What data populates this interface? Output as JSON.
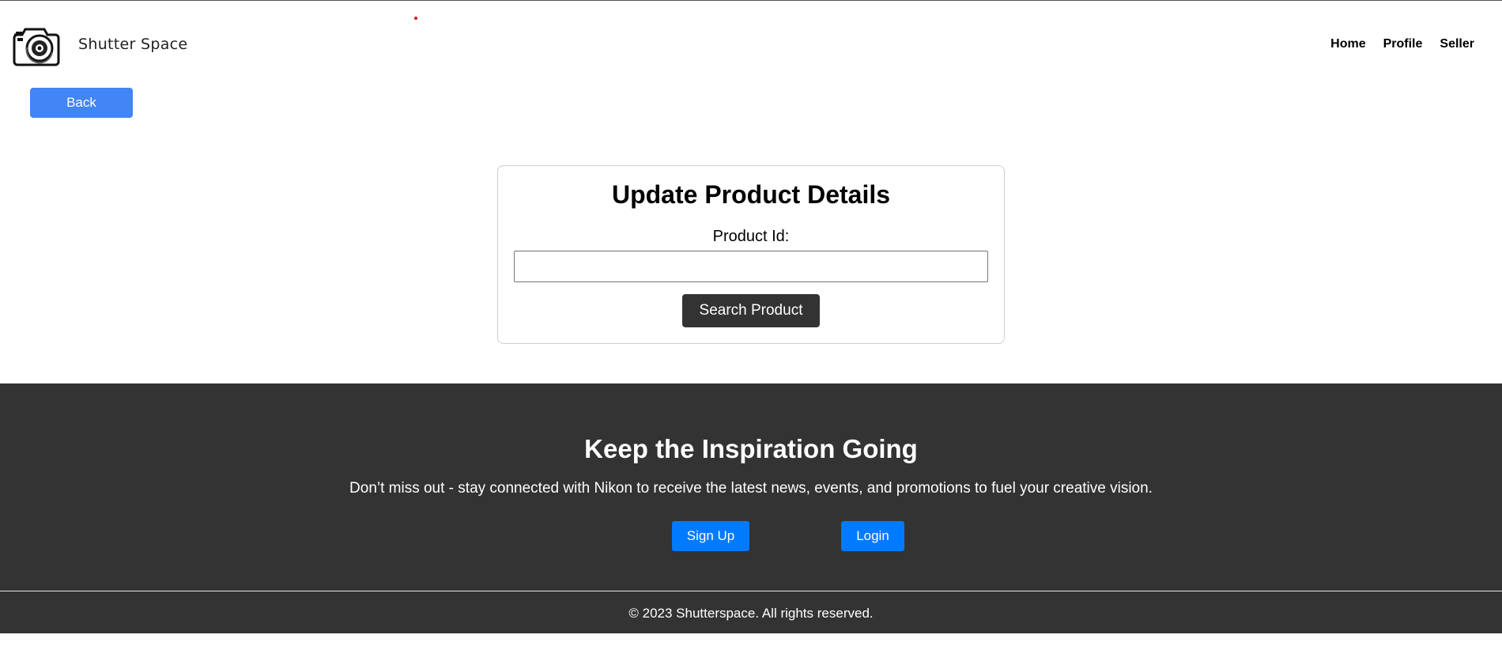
{
  "header": {
    "brand": "Shutter Space",
    "logo_icon": "camera-icon",
    "nav": [
      {
        "label": "Home"
      },
      {
        "label": "Profile"
      },
      {
        "label": "Seller"
      }
    ]
  },
  "back_button": {
    "label": "Back"
  },
  "update_card": {
    "title": "Update Product Details",
    "label": "Product Id:",
    "input_value": "",
    "button_label": "Search Product"
  },
  "cta": {
    "title": "Keep the Inspiration Going",
    "text": "Don’t miss out - stay connected with Nikon to receive the latest news, events, and promotions to fuel your creative vision.",
    "signup_label": "Sign Up",
    "login_label": "Login"
  },
  "footer": {
    "copyright": "© 2023 Shutterspace. All rights reserved."
  },
  "colors": {
    "primary_button": "#4285f4",
    "dark_bg": "#333333",
    "cta_button": "#007bff"
  }
}
